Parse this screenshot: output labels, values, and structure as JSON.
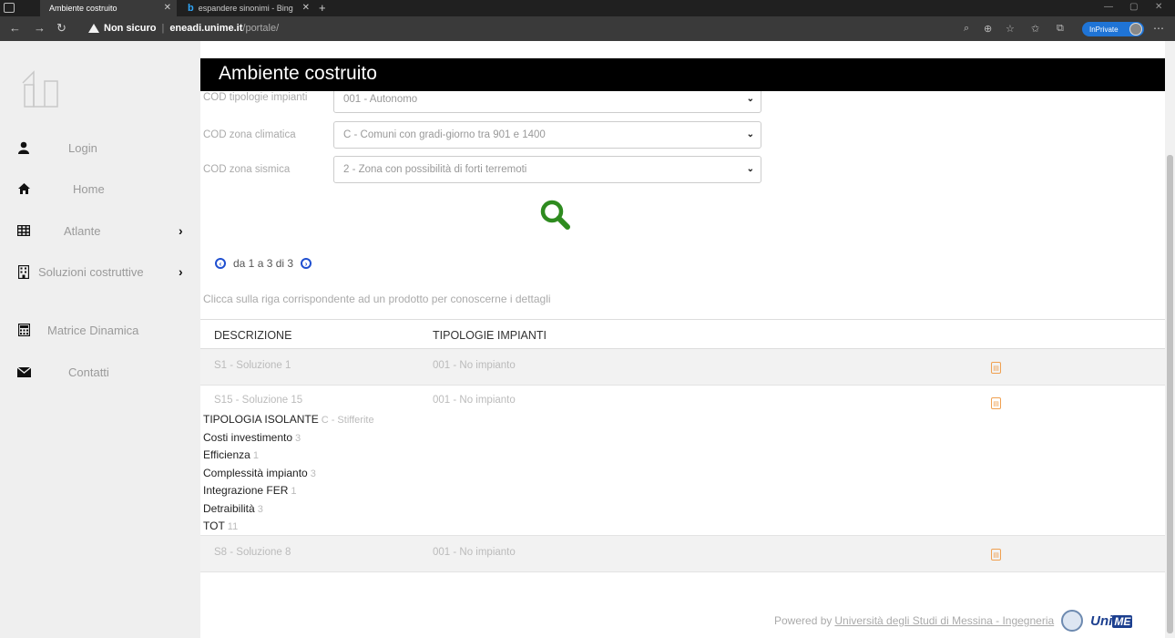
{
  "browser": {
    "tabs": [
      {
        "title": "Ambiente costruito",
        "active": true
      },
      {
        "title": "espandere sinonimi - Bing",
        "active": false
      }
    ],
    "not_secure": "Non sicuro",
    "url_host": "eneadi.unime.it",
    "url_path": "/portale/",
    "inprivate": "InPrivate"
  },
  "sidebar": {
    "items": [
      {
        "label": "Login",
        "icon": "user-icon"
      },
      {
        "label": "Home",
        "icon": "home-icon"
      },
      {
        "label": "Atlante",
        "icon": "grid-icon"
      },
      {
        "label": "Soluzioni costruttive",
        "icon": "building-icon"
      },
      {
        "label": "Matrice Dinamica",
        "icon": "calculator-icon"
      },
      {
        "label": "Contatti",
        "icon": "envelope-icon"
      }
    ]
  },
  "header": {
    "title": "Ambiente costruito"
  },
  "filters": [
    {
      "label": "COD tipologie impianti",
      "value": "001 - Autonomo"
    },
    {
      "label": "COD zona climatica",
      "value": "C - Comuni con gradi-giorno tra 901 e 1400"
    },
    {
      "label": "COD zona sismica",
      "value": "2 - Zona con possibilità di forti terremoti"
    }
  ],
  "pager": {
    "text": "da 1 a 3 di 3"
  },
  "hint": "Clicca sulla riga corrispondente ad un prodotto per conoscerne i dettagli",
  "table": {
    "headers": [
      "DESCRIZIONE",
      "TIPOLOGIE IMPIANTI"
    ],
    "rows": [
      {
        "descr": "S1 - Soluzione 1",
        "tipo": "001 - No impianto"
      },
      {
        "descr": "S15 - Soluzione 15",
        "tipo": "001 - No impianto"
      },
      {
        "descr": "S8 - Soluzione 8",
        "tipo": "001 - No impianto"
      }
    ],
    "details": [
      {
        "label": "TIPOLOGIA ISOLANTE",
        "value": "C - Stifferite"
      },
      {
        "label": "Costi investimento",
        "value": "3"
      },
      {
        "label": "Efficienza",
        "value": "1"
      },
      {
        "label": "Complessità impianto",
        "value": "3"
      },
      {
        "label": "Integrazione FER",
        "value": "1"
      },
      {
        "label": "Detraibilità",
        "value": "3"
      },
      {
        "label": "TOT",
        "value": "11"
      }
    ]
  },
  "footer": {
    "powered": "Powered by",
    "link": "Università degli Studi di Messina - Ingegneria",
    "logo_uni": "Uni",
    "logo_me": "ME"
  },
  "colors": {
    "search_icon": "#2e8b1f",
    "pager_blue": "#1f4fd0",
    "pdf_orange": "#f0a050"
  }
}
